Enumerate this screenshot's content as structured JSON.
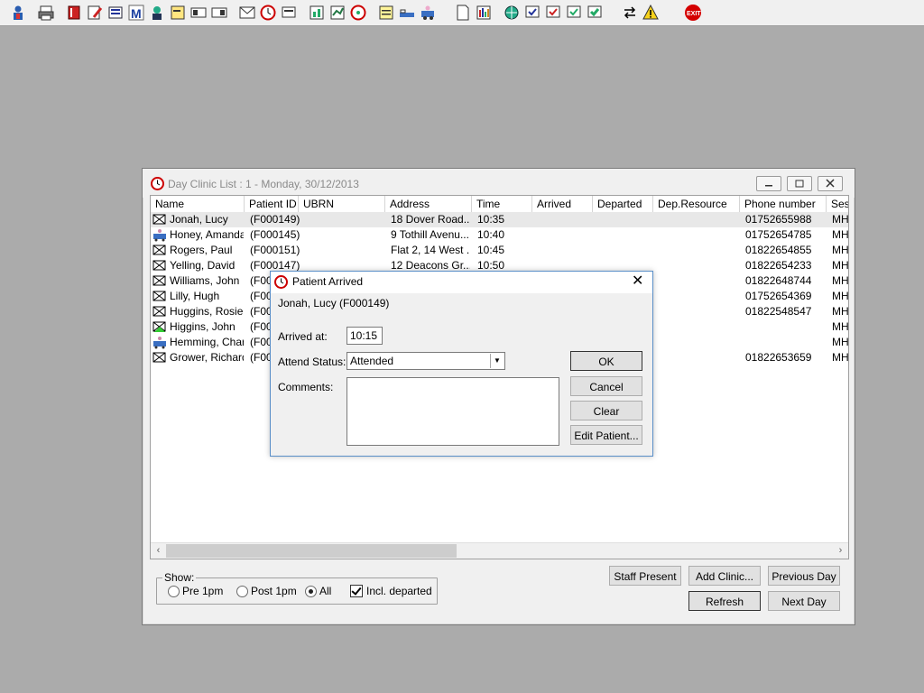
{
  "toolbar": {
    "icons": [
      "user-icon",
      "printer-icon",
      "book-icon",
      "edit-icon",
      "list-icon",
      "m-icon",
      "person-icon",
      "notes-icon",
      "card-icon",
      "card2-icon",
      "mail-icon",
      "clock-icon",
      "screen-icon",
      "chart-icon",
      "chart2-icon",
      "dial-icon",
      "sticky-icon",
      "bed-icon",
      "transport-icon",
      "document-icon",
      "bar-chart-icon",
      "globe-icon",
      "form-icon",
      "form2-icon",
      "form3-icon",
      "form4-icon",
      "swap-icon",
      "warning-icon",
      "exit-icon"
    ]
  },
  "window": {
    "title": "Day Clinic List : 1 - Monday, 30/12/2013",
    "columns": [
      "Name",
      "Patient ID",
      "UBRN",
      "Address",
      "Time",
      "Arrived",
      "Departed",
      "Dep.Resource",
      "Phone number",
      "Ses"
    ],
    "rows": [
      {
        "name": "Jonah, Lucy",
        "pid": "(F000149)",
        "address": "18 Dover Road...",
        "time": "10:35",
        "phone": "01752655988",
        "ses": "MH",
        "icon": "envelope-icon"
      },
      {
        "name": "Honey, Amanda",
        "pid": "(F000145)",
        "address": "9 Tothill Avenu...",
        "time": "10:40",
        "phone": "01752654785",
        "ses": "MH",
        "icon": "car-icon"
      },
      {
        "name": "Rogers, Paul",
        "pid": "(F000151)",
        "address": "Flat 2, 14 West ...",
        "time": "10:45",
        "phone": "01822654855",
        "ses": "MH",
        "icon": "envelope-icon"
      },
      {
        "name": "Yelling, David",
        "pid": "(F000147)",
        "address": "12 Deacons Gr...",
        "time": "10:50",
        "phone": "01822654233",
        "ses": "MH",
        "icon": "envelope-icon"
      },
      {
        "name": "Williams, John",
        "pid": "(F00",
        "address": "",
        "time": "",
        "phone": "01822648744",
        "ses": "MH",
        "icon": "envelope-icon"
      },
      {
        "name": "Lilly, Hugh",
        "pid": "(F00",
        "address": "",
        "time": "",
        "phone": "01752654369",
        "ses": "MH",
        "icon": "envelope-icon"
      },
      {
        "name": "Huggins, Rosie",
        "pid": "(F00",
        "address": "",
        "time": "",
        "phone": "01822548547",
        "ses": "MH",
        "icon": "envelope-icon"
      },
      {
        "name": "Higgins, John",
        "pid": "(F00",
        "address": "",
        "time": "",
        "phone": "",
        "ses": "MH",
        "icon": "envelope-green-icon"
      },
      {
        "name": "Hemming, Char...",
        "pid": "(F00",
        "address": "",
        "time": "",
        "phone": "",
        "ses": "MH",
        "icon": "car-icon"
      },
      {
        "name": "Grower, Richard",
        "pid": "(F00",
        "address": "",
        "time": "",
        "phone": "01822653659",
        "ses": "MH",
        "icon": "envelope-icon"
      }
    ],
    "show_label": "Show:",
    "options": [
      "Pre 1pm",
      "Post 1pm",
      "All"
    ],
    "incl_departed": "Incl. departed",
    "buttons": {
      "staff_present": "Staff Present",
      "add_clinic": "Add Clinic...",
      "previous_day": "Previous Day",
      "refresh": "Refresh",
      "next_day": "Next Day"
    }
  },
  "dialog": {
    "title": "Patient Arrived",
    "patient": "Jonah, Lucy (F000149)",
    "arrived_label": "Arrived at:",
    "arrived_value": "10:15",
    "status_label": "Attend Status:",
    "status_value": "Attended",
    "comments_label": "Comments:",
    "buttons": {
      "ok": "OK",
      "cancel": "Cancel",
      "clear": "Clear",
      "edit_patient": "Edit Patient..."
    }
  }
}
